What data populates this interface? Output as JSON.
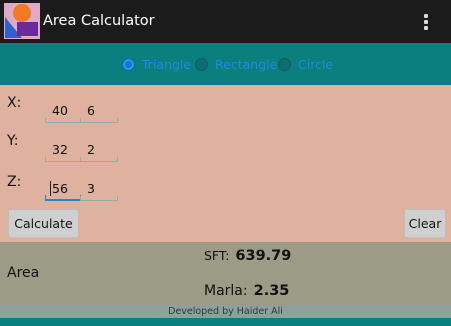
{
  "app": {
    "title": "Area Calculator",
    "icon": "area-calculator-app-icon"
  },
  "shapes": [
    {
      "label": "Triangle",
      "checked": true
    },
    {
      "label": "Rectangle",
      "checked": false
    },
    {
      "label": "Circle",
      "checked": false
    }
  ],
  "inputs": {
    "x": {
      "label": "X:",
      "a": "40",
      "b": "6"
    },
    "y": {
      "label": "Y:",
      "a": "32",
      "b": "2"
    },
    "z": {
      "label": "Z:",
      "a": "56",
      "b": "3"
    }
  },
  "buttons": {
    "calculate": "Calculate",
    "clear": "Clear"
  },
  "result": {
    "area_label": "Area",
    "sft_label": "SFT:",
    "sft_value": "639.79",
    "marla_label": "Marla:",
    "marla_value": "2.35"
  },
  "footer": "Developed by Haider Ali",
  "colors": {
    "action_bar": "#1b1b1b",
    "accent": "#0b7e7e",
    "form_bg": "#dfb29f",
    "result_bg": "#9c9c86",
    "radio_text": "#1e8ce0"
  }
}
